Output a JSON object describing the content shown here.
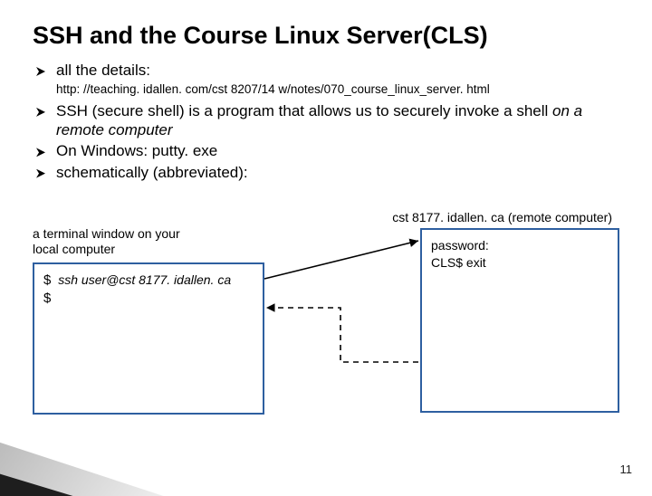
{
  "title": "SSH and the Course Linux Server(CLS)",
  "bullets": {
    "b1": "all the details:",
    "url": "http: //teaching. idallen. com/cst 8207/14 w/notes/070_course_linux_server. html",
    "b2a": "SSH (secure shell) is a program that allows us to securely invoke a shell ",
    "b2b": "on a remote computer",
    "b3": "On Windows: putty. exe",
    "b4": "schematically (abbreviated):"
  },
  "diagram": {
    "caption_left": "a terminal window on your local computer",
    "caption_right": "cst 8177. idallen. ca (remote computer)",
    "left_box": {
      "prompt1": "$",
      "cmd": "ssh user@cst 8177. idallen. ca",
      "prompt2": "$"
    },
    "right_box": {
      "line1": "password:",
      "line2": "CLS$ exit"
    }
  },
  "pagenum": "11"
}
